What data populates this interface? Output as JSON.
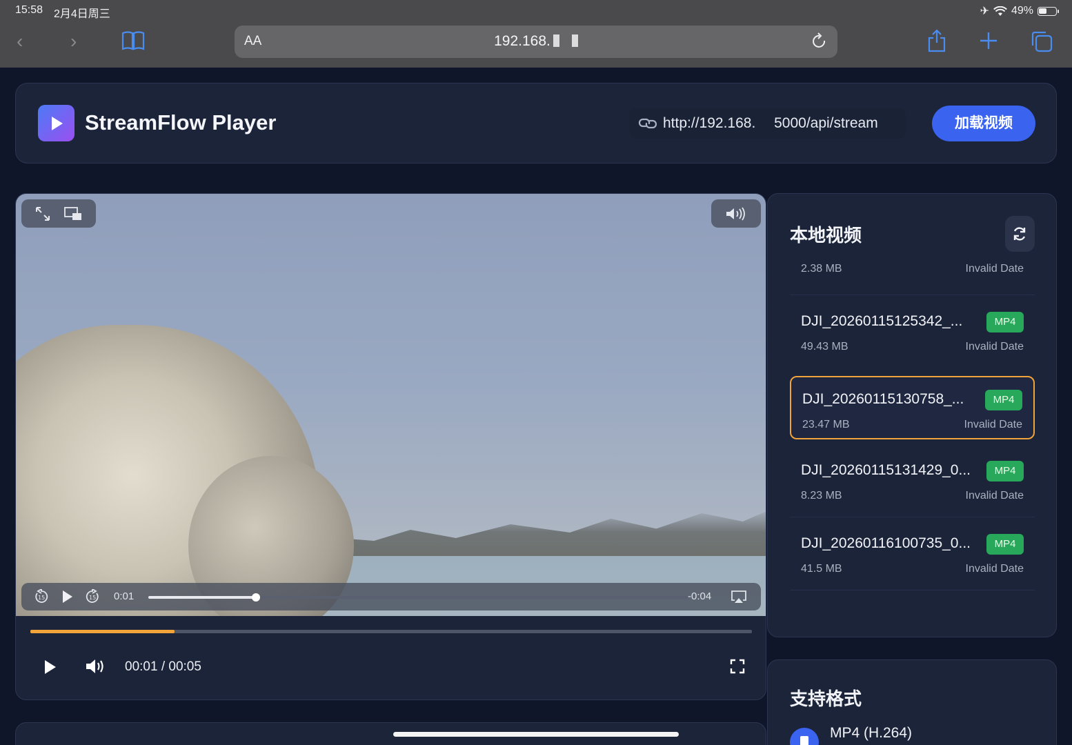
{
  "status_bar": {
    "time": "15:58",
    "date": "2月4日周三",
    "battery": "49%"
  },
  "browser": {
    "text_size_label": "AA",
    "url": "192.168."
  },
  "app": {
    "title": "StreamFlow Player",
    "url_input_value": "http://192.168.  5000/api/stream",
    "load_button": "加载视频"
  },
  "player": {
    "native_elapsed": "0:01",
    "native_remaining": "-0:04",
    "native_progress": 0.2,
    "progress": 0.2,
    "time_display": "00:01 / 00:05"
  },
  "sidebar": {
    "title": "本地视频",
    "partial_item": {
      "size": "2.38 MB",
      "date": "Invalid Date"
    },
    "videos": [
      {
        "name": "DJI_20260115125342_...",
        "format": "MP4",
        "size": "49.43 MB",
        "date": "Invalid Date",
        "selected": false
      },
      {
        "name": "DJI_20260115130758_...",
        "format": "MP4",
        "size": "23.47 MB",
        "date": "Invalid Date",
        "selected": true
      },
      {
        "name": "DJI_20260115131429_0...",
        "format": "MP4",
        "size": "8.23 MB",
        "date": "Invalid Date",
        "selected": false
      },
      {
        "name": "DJI_20260116100735_0...",
        "format": "MP4",
        "size": "41.5 MB",
        "date": "Invalid Date",
        "selected": false
      }
    ]
  },
  "formats": {
    "title": "支持格式",
    "items": [
      "MP4 (H.264)"
    ]
  },
  "colors": {
    "background": "#0f1629",
    "card": "#1c2439",
    "accent": "#3a63f0",
    "progress": "#f2a33a",
    "badge": "#27a85b"
  }
}
